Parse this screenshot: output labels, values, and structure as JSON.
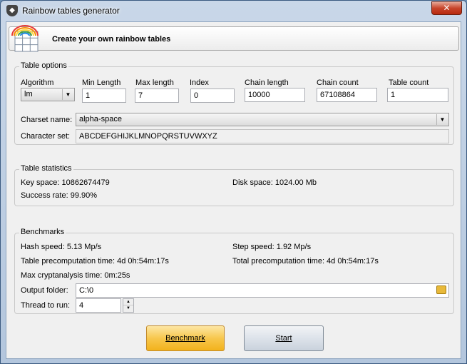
{
  "window": {
    "title": "Rainbow tables generator",
    "close_glyph": "✕"
  },
  "banner": {
    "text": "Create your own rainbow tables",
    "icon": "rainbow-table-icon"
  },
  "table_options": {
    "legend": "Table options",
    "algorithm": {
      "label": "Algorithm",
      "value": "lm"
    },
    "min_length": {
      "label": "Min Length",
      "value": "1"
    },
    "max_length": {
      "label": "Max length",
      "value": "7"
    },
    "index": {
      "label": "Index",
      "value": "0"
    },
    "chain_length": {
      "label": "Chain length",
      "value": "10000"
    },
    "chain_count": {
      "label": "Chain count",
      "value": "67108864"
    },
    "table_count": {
      "label": "Table count",
      "value": "1"
    },
    "charset_name": {
      "label": "Charset name:",
      "value": "alpha-space"
    },
    "character_set": {
      "label": "Character set:",
      "value": "ABCDEFGHIJKLMNOPQRSTUVWXYZ"
    }
  },
  "table_statistics": {
    "legend": "Table statistics",
    "key_space": "Key space: 10862674479",
    "disk_space": "Disk space: 1024.00 Mb",
    "success_rate": "Success rate: 99.90%"
  },
  "benchmarks": {
    "legend": "Benchmarks",
    "hash_speed": "Hash speed: 5.13 Mp/s",
    "step_speed": "Step speed: 1.92 Mp/s",
    "table_precomp": "Table precomputation time: 4d  0h:54m:17s",
    "total_precomp": "Total precomputation time: 4d  0h:54m:17s",
    "max_crypt": "Max cryptanalysis time: 0m:25s",
    "output_folder": {
      "label": "Output folder:",
      "value": "C:\\0"
    },
    "threads": {
      "label": "Thread to run:",
      "value": "4"
    }
  },
  "buttons": {
    "benchmark": "Benchmark",
    "start": "Start"
  },
  "colors": {
    "accent_button": "#f7c74d",
    "window_frame": "#b3c6dd"
  }
}
